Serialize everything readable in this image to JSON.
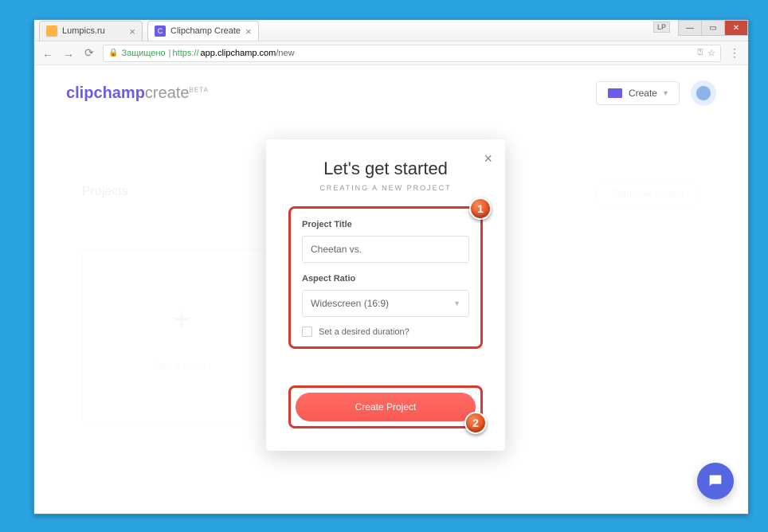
{
  "titlebar": {
    "lp": "LP"
  },
  "tabs": [
    {
      "title": "Lumpics.ru",
      "fav": ""
    },
    {
      "title": "Clipchamp Create",
      "fav": "C"
    }
  ],
  "address": {
    "secure": "Защищено",
    "proto": "https://",
    "host": "app.clipchamp.com",
    "path": "/new"
  },
  "header": {
    "logo1": "clipchamp",
    "logo2": "create",
    "beta": "BETA",
    "create_label": "Create"
  },
  "background": {
    "projects": "Projects",
    "start_card": "Start a project",
    "start_btn": "Start new project"
  },
  "modal": {
    "title": "Let's get started",
    "subtitle": "CREATING A NEW PROJECT",
    "project_title_label": "Project Title",
    "project_title_value": "Cheetan vs.",
    "aspect_label": "Aspect Ratio",
    "aspect_value": "Widescreen (16:9)",
    "duration_label": "Set a desired duration?",
    "create_btn": "Create Project"
  },
  "annotations": {
    "a1": "1",
    "a2": "2"
  }
}
